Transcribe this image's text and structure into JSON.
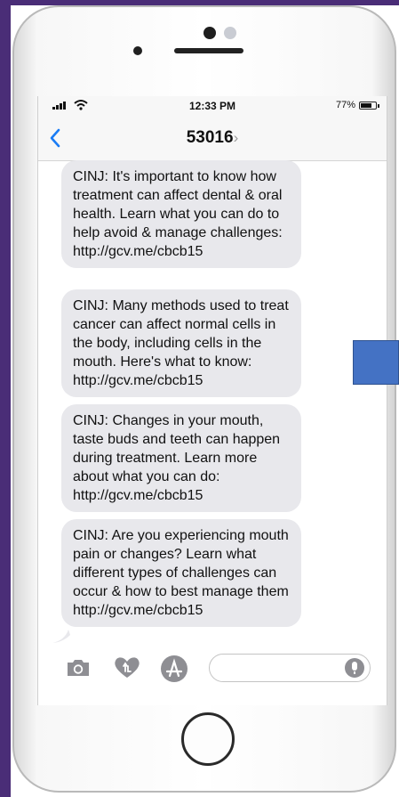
{
  "status_bar": {
    "time": "12:33 PM",
    "battery_pct": "77%",
    "battery_level": 0.77
  },
  "header": {
    "contact": "53016",
    "contact_chevron": "›"
  },
  "messages": [
    {
      "text": "CINJ: It's important to know how treatment can affect dental & oral health. Learn what you can do to help avoid & manage challenges: http://gcv.me/cbcb15"
    },
    {
      "text": "CINJ: Many methods used to treat cancer can affect normal cells in the body, including cells in the mouth. Here's what to know: http://gcv.me/cbcb15"
    },
    {
      "text": "CINJ: Changes in your mouth, taste buds and teeth can happen during treatment. Learn more about what you can do: http://gcv.me/cbcb15"
    },
    {
      "text": "CINJ: Are you experiencing mouth pain or changes? Learn what different types of challenges can occur & how to best manage them http://gcv.me/cbcb15"
    }
  ],
  "input_bar": {
    "placeholder": ""
  },
  "icons": {
    "back": "chevron-left-icon",
    "camera": "camera-icon",
    "heart": "digital-touch-heart-icon",
    "apps": "app-store-icon",
    "mic": "microphone-icon"
  },
  "colors": {
    "accent": "#1a7cf5",
    "bubble": "#e8e8ec",
    "frame_purple": "#4a2d77",
    "overlay_blue": "#4472c4"
  }
}
